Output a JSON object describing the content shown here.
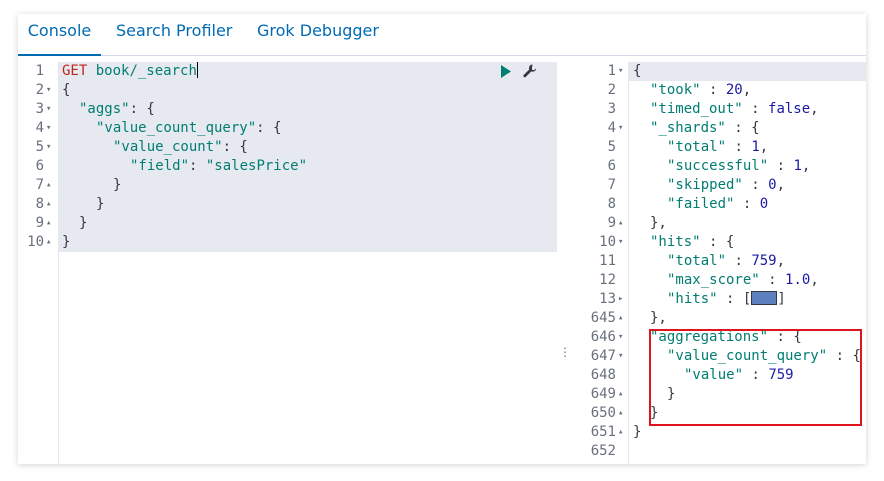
{
  "tabs": [
    {
      "label": "Console",
      "active": true
    },
    {
      "label": "Search Profiler",
      "active": false
    },
    {
      "label": "Grok Debugger",
      "active": false
    }
  ],
  "request": {
    "method": "GET",
    "url": "book/_search",
    "lines": [
      {
        "num": "1",
        "fold": ""
      },
      {
        "num": "2",
        "fold": "▾",
        "text": "{"
      },
      {
        "num": "3",
        "fold": "▾",
        "key": "\"aggs\"",
        "rest": ": {"
      },
      {
        "num": "4",
        "fold": "▾",
        "key": "\"value_count_query\"",
        "rest": ": {"
      },
      {
        "num": "5",
        "fold": "▾",
        "key": "\"value_count\"",
        "rest": ": {"
      },
      {
        "num": "6",
        "fold": "",
        "key": "\"field\"",
        "sep": ": ",
        "str": "\"salesPrice\""
      },
      {
        "num": "7",
        "fold": "▴",
        "text": "}"
      },
      {
        "num": "8",
        "fold": "▴",
        "text": "}"
      },
      {
        "num": "9",
        "fold": "▴",
        "text": "}"
      },
      {
        "num": "10",
        "fold": "▴",
        "text": "}"
      }
    ],
    "run_icon": "play-icon",
    "settings_icon": "wrench-icon"
  },
  "response": {
    "lines": [
      {
        "num": "1",
        "fold": "▾",
        "text": "{"
      },
      {
        "num": "2",
        "fold": "",
        "key": "\"took\"",
        "sep": " : ",
        "num_val": "20",
        "tail": ","
      },
      {
        "num": "3",
        "fold": "",
        "key": "\"timed_out\"",
        "sep": " : ",
        "num_val": "false",
        "tail": ","
      },
      {
        "num": "4",
        "fold": "▾",
        "key": "\"_shards\"",
        "sep": " : ",
        "tail": "{"
      },
      {
        "num": "5",
        "fold": "",
        "key": "\"total\"",
        "sep": " : ",
        "num_val": "1",
        "tail": ","
      },
      {
        "num": "6",
        "fold": "",
        "key": "\"successful\"",
        "sep": " : ",
        "num_val": "1",
        "tail": ","
      },
      {
        "num": "7",
        "fold": "",
        "key": "\"skipped\"",
        "sep": " : ",
        "num_val": "0",
        "tail": ","
      },
      {
        "num": "8",
        "fold": "",
        "key": "\"failed\"",
        "sep": " : ",
        "num_val": "0",
        "tail": ""
      },
      {
        "num": "9",
        "fold": "▴",
        "text": "},"
      },
      {
        "num": "10",
        "fold": "▾",
        "key": "\"hits\"",
        "sep": " : ",
        "tail": "{"
      },
      {
        "num": "11",
        "fold": "",
        "key": "\"total\"",
        "sep": " : ",
        "num_val": "759",
        "tail": ","
      },
      {
        "num": "12",
        "fold": "",
        "key": "\"max_score\"",
        "sep": " : ",
        "num_val": "1.0",
        "tail": ","
      },
      {
        "num": "13",
        "fold": "▸",
        "key": "\"hits\"",
        "sep": " : ",
        "tail": "["
      },
      {
        "num": "645",
        "fold": "▴",
        "text": "},"
      },
      {
        "num": "646",
        "fold": "▾",
        "key": "\"aggregations\"",
        "sep": " : ",
        "tail": "{"
      },
      {
        "num": "647",
        "fold": "▾",
        "key": "\"value_count_query\"",
        "sep": " : ",
        "tail": "{"
      },
      {
        "num": "648",
        "fold": "",
        "key": "\"value\"",
        "sep": " : ",
        "num_val": "759",
        "tail": ""
      },
      {
        "num": "649",
        "fold": "▴",
        "text": "}"
      },
      {
        "num": "650",
        "fold": "▴",
        "text": "}"
      },
      {
        "num": "651",
        "fold": "▴",
        "text": "}"
      },
      {
        "num": "652",
        "fold": "",
        "text": ""
      }
    ],
    "hits_collapsed_close": "]"
  },
  "colors": {
    "accent": "#006bb4",
    "highlight_border": "#e0141e",
    "request_bg": "#e6eaf0"
  }
}
